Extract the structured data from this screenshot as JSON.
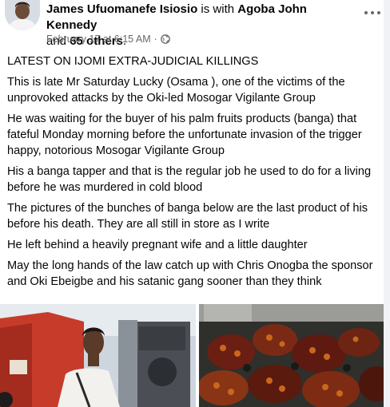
{
  "post": {
    "author": "James Ufuomanefe Isiosio",
    "with_text": "is with",
    "tagged_person": "Agoba John Kennedy",
    "and_text": "and",
    "others": "65 others",
    "timestamp": "February 17 at 6:15 AM",
    "separator": "·",
    "audience_icon": "globe-icon",
    "more_icon": "more-options-icon",
    "paragraphs": [
      "LATEST ON IJOMI EXTRA-JUDICIAL KILLINGS",
      "This is late Mr Saturday Lucky (Osama ), one of the victims of the unprovoked attacks by the Oki-led Mosogar Vigilante Group",
      "He was waiting for the buyer of his palm fruits products (banga) that fateful Monday morning before the unfortunate invasion of the trigger happy, notorious Mosogar Vigilante Group",
      "His a banga tapper and that is the regular job he used to do for a living before he was murdered in cold blood",
      "The pictures of the bunches of banga below are the last product of his before his death. They are all still in store as I write",
      "He left behind a heavily pregnant wife and a little daughter",
      "May the long hands of the law catch up with Chris Onogba the sponsor and Oki Ebeigbe and his satanic gang sooner than they think"
    ]
  },
  "colors": {
    "text": "#050505",
    "secondary": "#65676b"
  }
}
